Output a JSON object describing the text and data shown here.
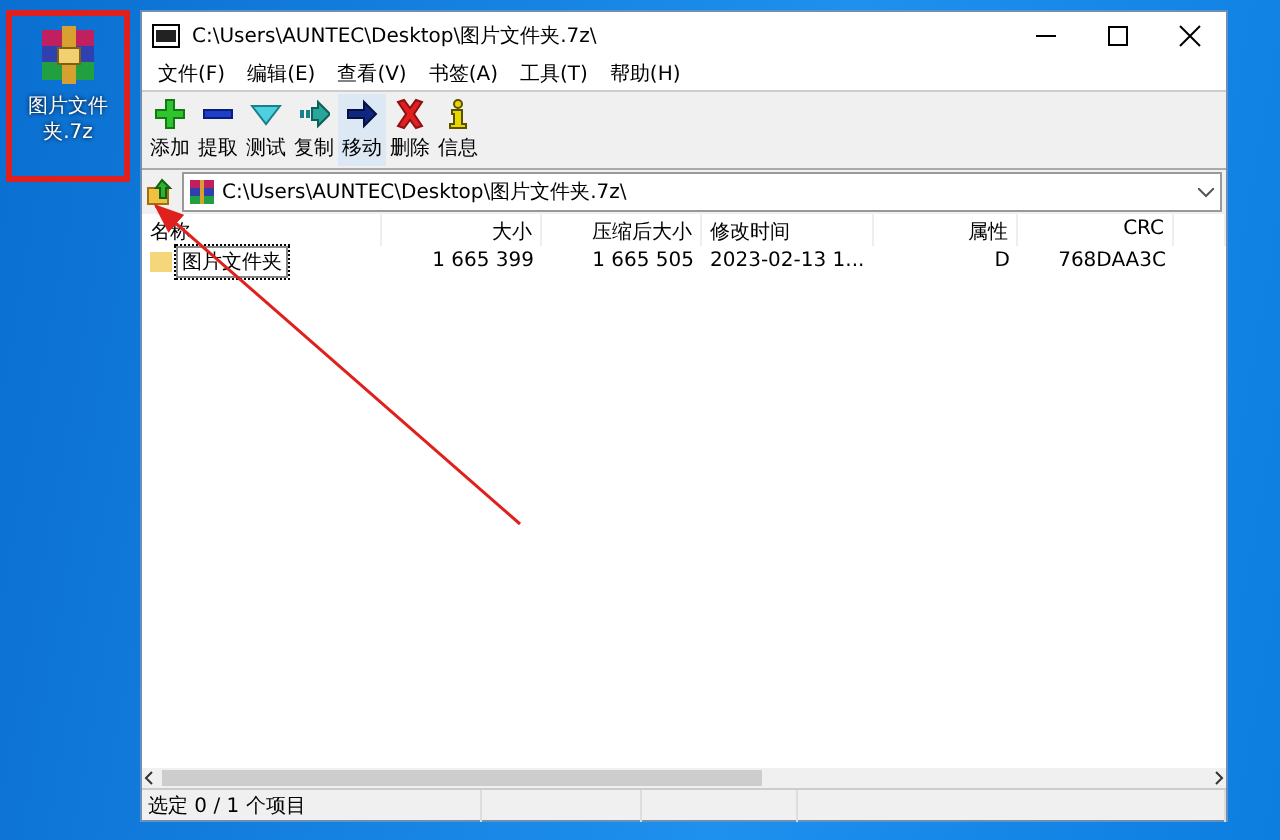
{
  "desktop_icon": {
    "label": "图片文件夹.7z"
  },
  "window": {
    "title": "C:\\Users\\AUNTEC\\Desktop\\图片文件夹.7z\\"
  },
  "menu": [
    "文件(F)",
    "编辑(E)",
    "查看(V)",
    "书签(A)",
    "工具(T)",
    "帮助(H)"
  ],
  "toolbar": [
    {
      "kind": "add",
      "label": "添加",
      "highlighted": false
    },
    {
      "kind": "extract",
      "label": "提取",
      "highlighted": false
    },
    {
      "kind": "test",
      "label": "测试",
      "highlighted": false
    },
    {
      "kind": "copy",
      "label": "复制",
      "highlighted": false
    },
    {
      "kind": "move",
      "label": "移动",
      "highlighted": true
    },
    {
      "kind": "delete",
      "label": "删除",
      "highlighted": false
    },
    {
      "kind": "info",
      "label": "信息",
      "highlighted": false
    }
  ],
  "address": {
    "path": "C:\\Users\\AUNTEC\\Desktop\\图片文件夹.7z\\"
  },
  "table": {
    "columns": [
      "名称",
      "大小",
      "压缩后大小",
      "修改时间",
      "属性",
      "CRC"
    ],
    "rows": [
      {
        "cells": [
          "图片文件夹",
          "1 665 399",
          "1 665 505",
          "2023-02-13 1...",
          "D",
          "768DAA3C"
        ],
        "focused": true
      }
    ]
  },
  "status_bar": {
    "text": "选定 0 / 1 个项目"
  }
}
